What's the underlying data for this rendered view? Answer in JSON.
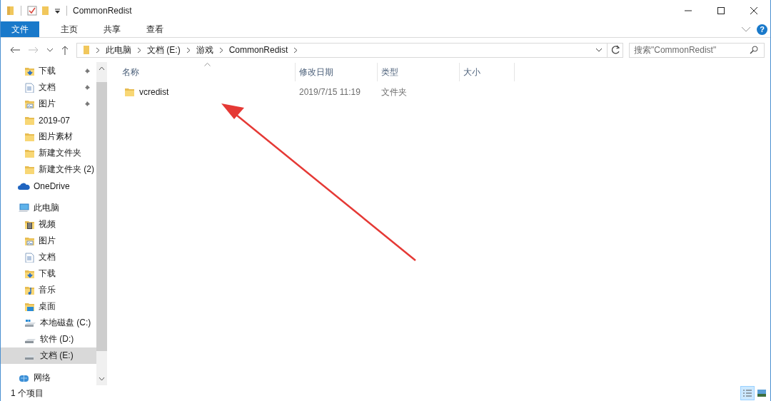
{
  "window": {
    "title": "CommonRedist"
  },
  "ribbon": {
    "tabs": [
      {
        "label": "文件",
        "selected": true
      },
      {
        "label": "主页",
        "selected": false
      },
      {
        "label": "共享",
        "selected": false
      },
      {
        "label": "查看",
        "selected": false
      }
    ],
    "help": "?"
  },
  "address": {
    "crumbs": [
      "此电脑",
      "文档 (E:)",
      "游戏",
      "CommonRedist"
    ]
  },
  "search": {
    "placeholder": "搜索\"CommonRedist\""
  },
  "sidebar": {
    "quick_access": [
      {
        "label": "下载",
        "kind": "download",
        "pinned": true
      },
      {
        "label": "文档",
        "kind": "documents",
        "pinned": true
      },
      {
        "label": "图片",
        "kind": "pictures",
        "pinned": true
      },
      {
        "label": "2019-07",
        "kind": "folder",
        "pinned": false
      },
      {
        "label": "图片素材",
        "kind": "folder",
        "pinned": false
      },
      {
        "label": "新建文件夹",
        "kind": "folder",
        "pinned": false
      },
      {
        "label": "新建文件夹 (2)",
        "kind": "folder",
        "pinned": false
      }
    ],
    "items": [
      {
        "label": "OneDrive",
        "kind": "cloud",
        "selected": false
      },
      {
        "label": "此电脑",
        "kind": "pc",
        "selected": false,
        "children": [
          {
            "label": "视频",
            "kind": "videos",
            "selected": false
          },
          {
            "label": "图片",
            "kind": "pictures",
            "selected": false
          },
          {
            "label": "文档",
            "kind": "documents",
            "selected": false
          },
          {
            "label": "下载",
            "kind": "download",
            "selected": false
          },
          {
            "label": "音乐",
            "kind": "music",
            "selected": false
          },
          {
            "label": "桌面",
            "kind": "desktop",
            "selected": false
          },
          {
            "label": "本地磁盘 (C:)",
            "kind": "system_drive",
            "selected": false
          },
          {
            "label": "软件 (D:)",
            "kind": "drive",
            "selected": false
          },
          {
            "label": "文档 (E:)",
            "kind": "drive",
            "selected": true
          }
        ]
      },
      {
        "label": "网络",
        "kind": "network",
        "selected": false
      }
    ]
  },
  "table": {
    "columns": [
      {
        "label": "名称",
        "sorted": true
      },
      {
        "label": "修改日期",
        "sorted": false
      },
      {
        "label": "类型",
        "sorted": false
      },
      {
        "label": "大小",
        "sorted": false
      }
    ],
    "rows": [
      {
        "name": "vcredist",
        "modified": "2019/7/15 11:19",
        "type": "文件夹",
        "size": ""
      }
    ]
  },
  "status_bar": {
    "text": "1 个项目",
    "view_buttons": [
      {
        "kind": "details",
        "selected": true
      },
      {
        "kind": "large_icons",
        "selected": false
      }
    ]
  }
}
